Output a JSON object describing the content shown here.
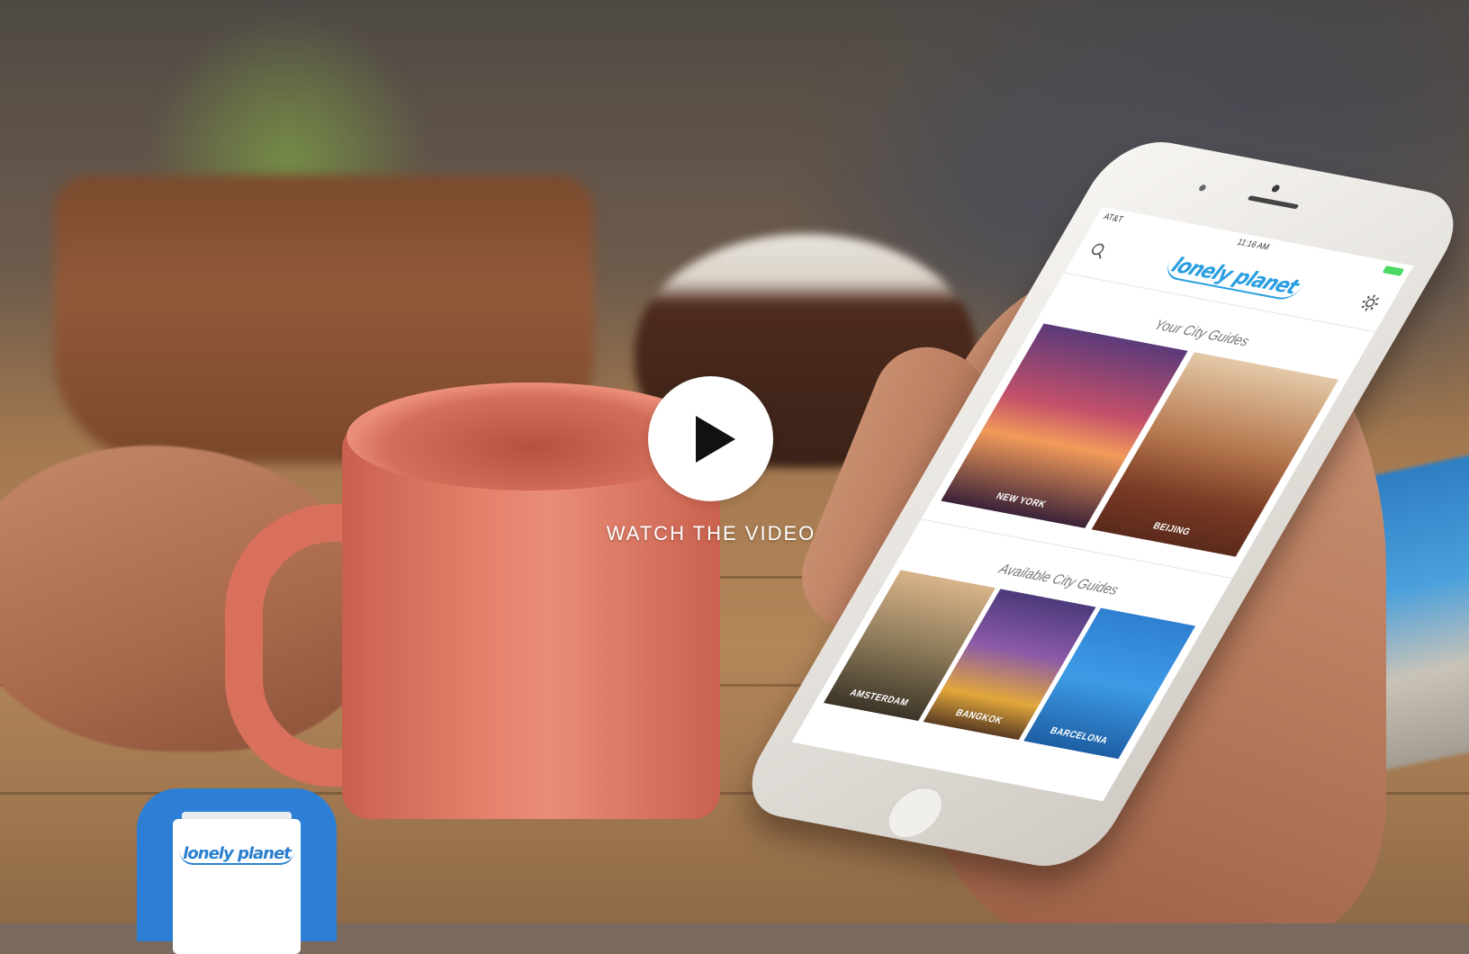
{
  "video_overlay": {
    "play_icon": "play-icon",
    "label": "WATCH THE VIDEO"
  },
  "phone_app": {
    "status": {
      "carrier": "AT&T",
      "time": "11:16 AM"
    },
    "brand": "lonely planet",
    "icons": {
      "search": "search-icon",
      "settings": "gear-icon"
    },
    "your_guides_title": "Your City Guides",
    "your_guides": [
      {
        "name": "NEW YORK"
      },
      {
        "name": "BEIJING"
      }
    ],
    "available_title": "Available City Guides",
    "available_guides": [
      {
        "name": "AMSTERDAM"
      },
      {
        "name": "BANGKOK"
      },
      {
        "name": "BARCELONA"
      }
    ]
  },
  "app_icon": {
    "brand": "lonely planet"
  },
  "colors": {
    "brand_blue": "#2a9ee0",
    "app_icon_bg": "#2c7fd4",
    "play_button": "#ffffff"
  }
}
